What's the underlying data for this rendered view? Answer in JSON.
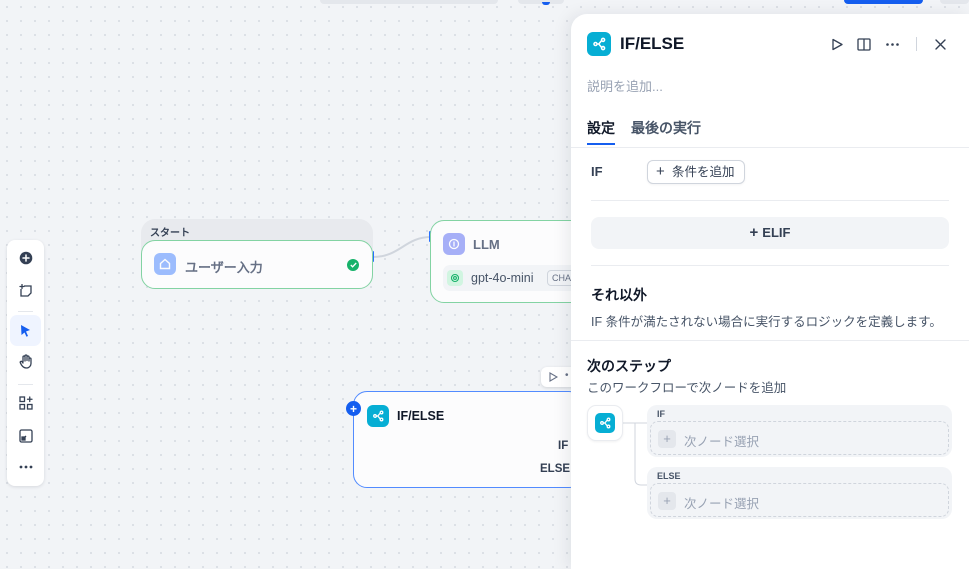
{
  "canvas": {
    "start_node": {
      "header": "スタート",
      "title": "ユーザー入力"
    },
    "llm_node": {
      "title": "LLM",
      "model": "gpt-4o-mini",
      "model_badge": "CHA"
    },
    "ifelse_node": {
      "title": "IF/ELSE",
      "conditions": [
        "IF",
        "ELSE"
      ]
    }
  },
  "toolbar": {
    "items": [
      "add-node",
      "add-note",
      "pointer-mode",
      "hand-mode",
      "organize",
      "minimap",
      "more"
    ]
  },
  "panel": {
    "title": "IF/ELSE",
    "description_placeholder": "説明を追加...",
    "tabs": [
      "設定",
      "最後の実行"
    ],
    "active_tab": "設定",
    "if_label": "IF",
    "add_condition": "条件を追加",
    "elif_button": "ELIF",
    "else_section": {
      "title": "それ以外",
      "description": "IF 条件が満たされない場合に実行するロジックを定義します。"
    },
    "next_step": {
      "title": "次のステップ",
      "description": "このワークフローで次ノードを追加",
      "branches": [
        {
          "label": "IF",
          "placeholder": "次ノード選択"
        },
        {
          "label": "ELSE",
          "placeholder": "次ノード選択"
        }
      ]
    }
  },
  "colors": {
    "accent": "#155eef",
    "ifelse_icon": "#06aed4",
    "llm_icon": "#6172f3",
    "start_icon": "#2970ff",
    "success": "#17b26a"
  }
}
